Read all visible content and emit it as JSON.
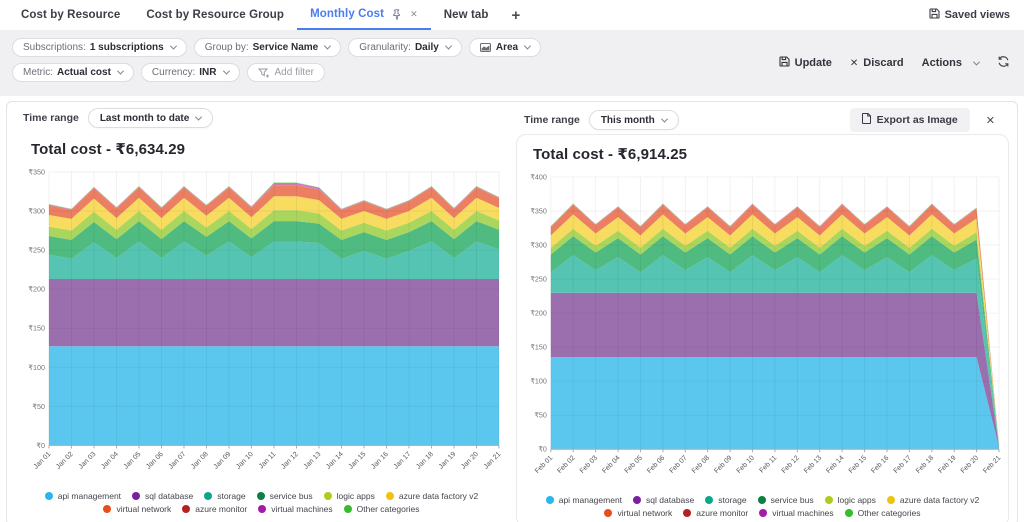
{
  "tabs_bar": {
    "tabs": [
      {
        "label": "Cost by Resource"
      },
      {
        "label": "Cost by Resource Group"
      },
      {
        "label": "Monthly Cost"
      },
      {
        "label": "New tab"
      }
    ],
    "add_tab_label": "+",
    "active_tab_close": "✕",
    "saved_views_label": "Saved views"
  },
  "filter_bar": {
    "subscriptions": {
      "label": "Subscriptions:",
      "value": "1 subscriptions"
    },
    "group_by": {
      "label": "Group by:",
      "value": "Service Name"
    },
    "granularity": {
      "label": "Granularity:",
      "value": "Daily"
    },
    "chart_type": {
      "value": "Area"
    },
    "metric": {
      "label": "Metric:",
      "value": "Actual cost"
    },
    "currency": {
      "label": "Currency:",
      "value": "INR"
    },
    "add_filter_label": "Add filter",
    "update_label": "Update",
    "discard_label": "Discard",
    "discard_icon": "✕",
    "actions_label": "Actions"
  },
  "panels": [
    {
      "time_range_label": "Time range",
      "time_range_value": "Last month to date"
    },
    {
      "time_range_label": "Time range",
      "time_range_value": "This month",
      "export_label": "Export as Image",
      "close_icon": "✕"
    }
  ],
  "chart_data": [
    {
      "type": "area",
      "stacked": true,
      "title": "Total cost - ₹6,634.29",
      "time_range": "Last month to date",
      "currency": "₹",
      "ylim": [
        0,
        350
      ],
      "ytick": 50,
      "grid": true,
      "legend_position": "bottom",
      "x": [
        "Jan 01",
        "Jan 02",
        "Jan 03",
        "Jan 04",
        "Jan 05",
        "Jan 06",
        "Jan 07",
        "Jan 08",
        "Jan 09",
        "Jan 10",
        "Jan 11",
        "Jan 12",
        "Jan 13",
        "Jan 14",
        "Jan 15",
        "Jan 16",
        "Jan 17",
        "Jan 18",
        "Jan 19",
        "Jan 20",
        "Jan 21"
      ],
      "series": [
        {
          "name": "api management",
          "dot_color": "#29b6ea",
          "fill_color": "#5cc7ee",
          "values": [
            127,
            127,
            127,
            127,
            127,
            127,
            127,
            127,
            127,
            127,
            127,
            127,
            127,
            127,
            127,
            127,
            127,
            127,
            127,
            127,
            127
          ]
        },
        {
          "name": "sql database",
          "dot_color": "#7b1fa2",
          "fill_color": "#9b6fae",
          "values": [
            86,
            86,
            86,
            86,
            86,
            86,
            86,
            86,
            86,
            86,
            86,
            86,
            86,
            86,
            86,
            86,
            86,
            86,
            86,
            86,
            86
          ]
        },
        {
          "name": "storage",
          "dot_color": "#0ba789",
          "fill_color": "#55c4b2",
          "values": [
            31,
            26,
            47,
            27,
            48,
            27,
            48,
            30,
            48,
            28,
            48,
            48,
            46,
            26,
            36,
            26,
            36,
            48,
            27,
            48,
            38
          ]
        },
        {
          "name": "service bus",
          "dot_color": "#0b8043",
          "fill_color": "#4fbb80",
          "values": [
            24,
            24,
            26,
            24,
            26,
            24,
            26,
            24,
            26,
            24,
            26,
            26,
            25,
            24,
            24,
            24,
            24,
            26,
            24,
            26,
            25
          ]
        },
        {
          "name": "logic apps",
          "dot_color": "#b0cb1f",
          "fill_color": "#abd65d",
          "values": [
            12,
            12,
            13,
            12,
            13,
            12,
            13,
            12,
            13,
            12,
            14,
            14,
            13,
            12,
            12,
            12,
            12,
            13,
            12,
            13,
            12
          ]
        },
        {
          "name": "azure data factory v2",
          "dot_color": "#eec213",
          "fill_color": "#f7dc60",
          "values": [
            15,
            15,
            17,
            15,
            17,
            15,
            17,
            15,
            17,
            15,
            18,
            18,
            17,
            15,
            15,
            15,
            15,
            17,
            15,
            17,
            16
          ]
        },
        {
          "name": "virtual network",
          "dot_color": "#e84e1c",
          "fill_color": "#ec7e61",
          "values": [
            12,
            11,
            13,
            12,
            13,
            12,
            13,
            12,
            13,
            12,
            14,
            14,
            13,
            11,
            12,
            11,
            12,
            13,
            11,
            13,
            12
          ]
        },
        {
          "name": "azure monitor",
          "dot_color": "#b62020",
          "fill_color": "#d97f7a",
          "values": [
            1,
            1,
            1,
            1,
            1,
            1,
            1,
            1,
            1,
            1,
            1,
            1,
            1,
            1,
            1,
            1,
            1,
            1,
            1,
            1,
            1
          ]
        },
        {
          "name": "virtual machines",
          "dot_color": "#a31ba8",
          "fill_color": "#c678cc",
          "values": [
            0.5,
            0.5,
            0.5,
            0.5,
            0.5,
            0.5,
            0.5,
            0.5,
            0.5,
            0.5,
            2,
            2,
            2,
            0.5,
            0.5,
            0.5,
            0.5,
            0.5,
            0.5,
            0.5,
            0.5
          ]
        },
        {
          "name": "Other categories",
          "dot_color": "#35bd2e",
          "fill_color": "#8bdc7f",
          "values": [
            0.5,
            0.5,
            0.5,
            0.5,
            0.5,
            0.5,
            0.5,
            0.5,
            0.5,
            0.5,
            0.5,
            0.5,
            0.5,
            0.5,
            0.5,
            0.5,
            0.5,
            0.5,
            0.5,
            0.5,
            0.5
          ]
        }
      ]
    },
    {
      "type": "area",
      "stacked": true,
      "title": "Total cost - ₹6,914.25",
      "time_range": "This month",
      "currency": "₹",
      "ylim": [
        0,
        400
      ],
      "ytick": 50,
      "grid": true,
      "legend_position": "bottom",
      "x": [
        "Feb 01",
        "Feb 02",
        "Feb 03",
        "Feb 04",
        "Feb 05",
        "Feb 06",
        "Feb 07",
        "Feb 08",
        "Feb 09",
        "Feb 10",
        "Feb 11",
        "Feb 12",
        "Feb 13",
        "Feb 14",
        "Feb 15",
        "Feb 16",
        "Feb 17",
        "Feb 18",
        "Feb 19",
        "Feb 20",
        "Feb 21"
      ],
      "series": [
        {
          "name": "api management",
          "dot_color": "#29b6ea",
          "fill_color": "#5cc7ee",
          "values": [
            135,
            135,
            135,
            135,
            135,
            135,
            135,
            135,
            135,
            135,
            135,
            135,
            135,
            135,
            135,
            135,
            135,
            135,
            135,
            135,
            3
          ]
        },
        {
          "name": "sql database",
          "dot_color": "#7b1fa2",
          "fill_color": "#9b6fae",
          "values": [
            95,
            95,
            95,
            95,
            95,
            95,
            95,
            95,
            95,
            95,
            95,
            95,
            95,
            95,
            95,
            95,
            95,
            95,
            95,
            95,
            1
          ]
        },
        {
          "name": "storage",
          "dot_color": "#0ba789",
          "fill_color": "#55c4b2",
          "values": [
            30,
            55,
            33,
            52,
            30,
            55,
            33,
            52,
            30,
            55,
            33,
            52,
            30,
            55,
            33,
            52,
            30,
            55,
            33,
            50,
            1
          ]
        },
        {
          "name": "service bus",
          "dot_color": "#0b8043",
          "fill_color": "#4fbb80",
          "values": [
            26,
            28,
            26,
            28,
            26,
            28,
            26,
            28,
            26,
            28,
            26,
            28,
            26,
            28,
            26,
            28,
            26,
            28,
            26,
            28,
            0.5
          ]
        },
        {
          "name": "logic apps",
          "dot_color": "#b0cb1f",
          "fill_color": "#abd65d",
          "values": [
            10,
            11,
            10,
            11,
            10,
            11,
            10,
            11,
            10,
            11,
            10,
            11,
            10,
            11,
            10,
            11,
            10,
            11,
            10,
            11,
            0.3
          ]
        },
        {
          "name": "azure data factory v2",
          "dot_color": "#eec213",
          "fill_color": "#f7dc60",
          "values": [
            18,
            21,
            18,
            20,
            18,
            21,
            18,
            20,
            18,
            21,
            18,
            20,
            18,
            21,
            18,
            20,
            18,
            21,
            18,
            20,
            0.4
          ]
        },
        {
          "name": "virtual network",
          "dot_color": "#e84e1c",
          "fill_color": "#ec7e61",
          "values": [
            12,
            14,
            12,
            14,
            12,
            14,
            12,
            14,
            12,
            14,
            12,
            14,
            12,
            14,
            12,
            14,
            12,
            14,
            12,
            14,
            0.3
          ]
        },
        {
          "name": "azure monitor",
          "dot_color": "#b62020",
          "fill_color": "#d97f7a",
          "values": [
            1,
            1,
            1,
            1,
            1,
            1,
            1,
            1,
            1,
            1,
            1,
            1,
            1,
            1,
            1,
            1,
            1,
            1,
            1,
            1,
            0.1
          ]
        },
        {
          "name": "virtual machines",
          "dot_color": "#a31ba8",
          "fill_color": "#c678cc",
          "values": [
            0.5,
            0.5,
            0.5,
            0.5,
            0.5,
            0.5,
            0.5,
            0.5,
            0.5,
            0.5,
            0.5,
            0.5,
            0.5,
            0.5,
            0.5,
            0.5,
            0.5,
            0.5,
            0.5,
            0.5,
            0.05
          ]
        },
        {
          "name": "Other categories",
          "dot_color": "#35bd2e",
          "fill_color": "#8bdc7f",
          "values": [
            0.5,
            0.5,
            0.5,
            0.5,
            0.5,
            0.5,
            0.5,
            0.5,
            0.5,
            0.5,
            0.5,
            0.5,
            0.5,
            0.5,
            0.5,
            0.5,
            0.5,
            0.5,
            0.5,
            0.5,
            0.05
          ]
        }
      ]
    }
  ]
}
